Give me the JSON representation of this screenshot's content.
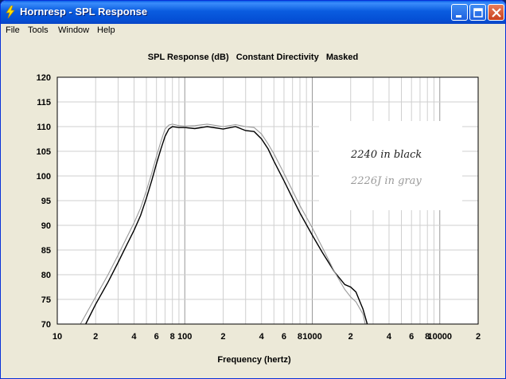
{
  "window": {
    "title": "Hornresp - SPL Response",
    "buttons": [
      "minimize-icon",
      "maximize-icon",
      "close-icon"
    ]
  },
  "menu": [
    "File",
    "Tools",
    "Window",
    "Help"
  ],
  "chart_header": "SPL Response (dB)   Constant Directivity   Masked",
  "colors": {
    "titlebar": "#0a5cdf",
    "plot_bg": "#ffffff",
    "client_bg": "#ece9d8",
    "series_black": "#000000",
    "series_gray": "#999999"
  },
  "chart_data": {
    "type": "line",
    "title": "SPL Response (dB)   Constant Directivity   Masked",
    "xlabel": "Frequency (hertz)",
    "ylabel": "",
    "x_scale": "log",
    "xlim": [
      10,
      20000
    ],
    "ylim": [
      70,
      120
    ],
    "grid": true,
    "y_ticks": [
      "120",
      "115",
      "110",
      "105",
      "100",
      "95",
      "90",
      "85",
      "80",
      "75",
      "70"
    ],
    "x_ticks": [
      {
        "value": 10,
        "label": "10"
      },
      {
        "value": 20,
        "label": "2"
      },
      {
        "value": 40,
        "label": "4"
      },
      {
        "value": 60,
        "label": "6"
      },
      {
        "value": 80,
        "label": "8"
      },
      {
        "value": 100,
        "label": "100"
      },
      {
        "value": 200,
        "label": "2"
      },
      {
        "value": 400,
        "label": "4"
      },
      {
        "value": 600,
        "label": "6"
      },
      {
        "value": 800,
        "label": "8"
      },
      {
        "value": 1000,
        "label": "1000"
      },
      {
        "value": 2000,
        "label": "2"
      },
      {
        "value": 4000,
        "label": "4"
      },
      {
        "value": 6000,
        "label": "6"
      },
      {
        "value": 8000,
        "label": "8"
      },
      {
        "value": 10000,
        "label": "10000"
      },
      {
        "value": 20000,
        "label": "2"
      }
    ],
    "annotations": [
      "2240 in black",
      "2226J in gray"
    ],
    "series": [
      {
        "color": "#000000",
        "x": [
          16.7,
          20,
          25,
          30,
          35,
          40,
          45,
          50,
          55,
          60,
          65,
          70,
          75,
          80,
          90,
          100,
          120,
          150,
          200,
          250,
          300,
          350,
          400,
          450,
          500,
          600,
          700,
          800,
          1000,
          1200,
          1500,
          1800,
          2000,
          2200,
          2500,
          2700
        ],
        "y": [
          70,
          74.0,
          78.5,
          82.5,
          86.0,
          89.0,
          92.0,
          95.5,
          99.0,
          102.5,
          105.5,
          108.0,
          109.5,
          110.0,
          109.8,
          109.8,
          109.6,
          110.0,
          109.5,
          110.0,
          109.2,
          109.0,
          107.5,
          105.5,
          103.0,
          99.0,
          95.5,
          92.5,
          88.0,
          84.5,
          80.5,
          78.0,
          77.5,
          76.5,
          73.0,
          70
        ]
      },
      {
        "color": "#999999",
        "x": [
          15.2,
          20,
          25,
          30,
          35,
          40,
          45,
          50,
          55,
          60,
          65,
          70,
          75,
          80,
          90,
          100,
          120,
          150,
          200,
          250,
          300,
          350,
          400,
          450,
          500,
          600,
          700,
          800,
          1000,
          1200,
          1500,
          1800,
          2000,
          2200,
          2500,
          2600
        ],
        "y": [
          70,
          75.5,
          80.0,
          84.0,
          87.5,
          90.5,
          93.5,
          97.0,
          100.5,
          104.0,
          107.0,
          109.5,
          110.3,
          110.5,
          110.2,
          110.1,
          110.2,
          110.5,
          110.0,
          110.4,
          110.0,
          109.8,
          108.5,
          106.5,
          104.5,
          100.5,
          97.0,
          94.0,
          89.5,
          85.5,
          80.5,
          77.0,
          75.5,
          74.5,
          72.0,
          70
        ]
      }
    ]
  }
}
